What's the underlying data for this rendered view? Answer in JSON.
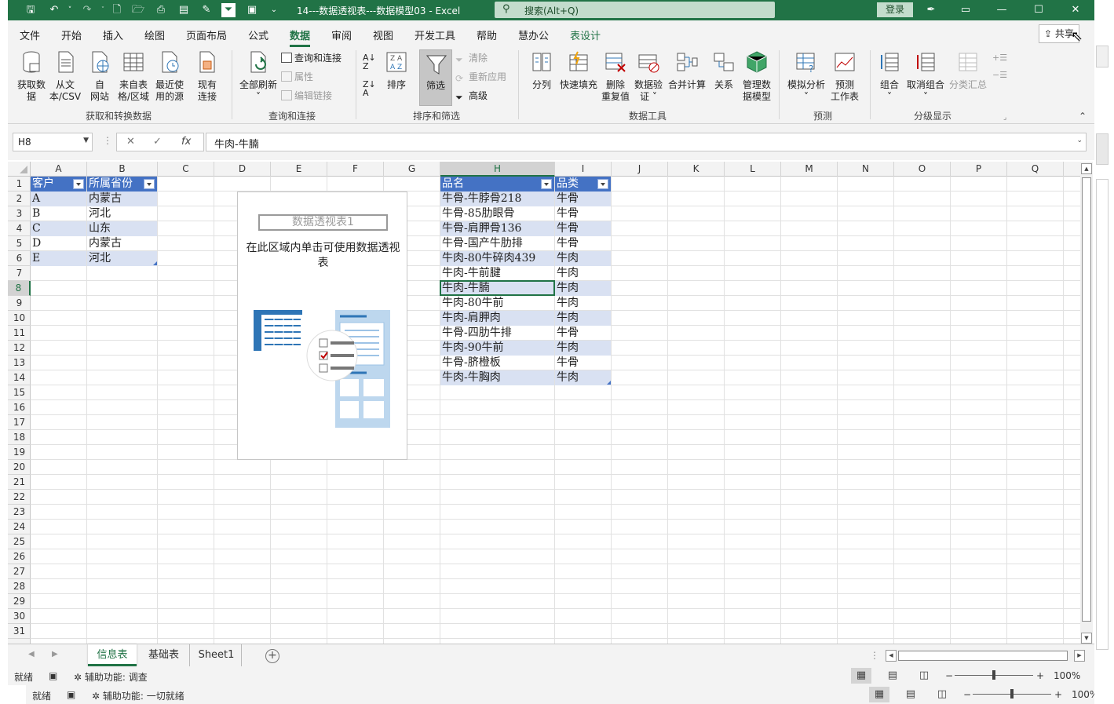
{
  "window": {
    "title": "14---数据透视表---数据模型03  -  Excel",
    "search_placeholder": "搜索(Alt+Q)",
    "login": "登录"
  },
  "menu": {
    "tabs": [
      "文件",
      "开始",
      "插入",
      "绘图",
      "页面布局",
      "公式",
      "数据",
      "审阅",
      "视图",
      "开发工具",
      "帮助",
      "慧办公",
      "表设计"
    ],
    "active": "数据",
    "share": "共享"
  },
  "ribbon": {
    "get_data": [
      "获取数",
      "据"
    ],
    "from_text": [
      "从文",
      "本/CSV"
    ],
    "from_web": [
      "自",
      "网站"
    ],
    "from_table": [
      "来自表",
      "格/区域"
    ],
    "recent_sources": [
      "最近使",
      "用的源"
    ],
    "existing": [
      "现有",
      "连接"
    ],
    "group_get": "获取和转换数据",
    "refresh_all": [
      "全部刷新",
      "˅"
    ],
    "queries": "查询和连接",
    "properties": "属性",
    "edit_links": "编辑链接",
    "group_queries": "查询和连接",
    "sort": "排序",
    "filter": "筛选",
    "clear": "清除",
    "reapply": "重新应用",
    "advanced": "高级",
    "group_sort": "排序和筛选",
    "text_to_columns": "分列",
    "flash_fill": "快速填充",
    "remove_dup": [
      "删除",
      "重复值"
    ],
    "validation": [
      "数据验",
      "证 ˅"
    ],
    "consolidate": "合并计算",
    "relationships": "关系",
    "manage_model": [
      "管理数",
      "据模型"
    ],
    "group_tools": "数据工具",
    "what_if": [
      "模拟分析",
      "˅"
    ],
    "forecast": [
      "预测",
      "工作表"
    ],
    "group_forecast": "预测",
    "group_btn": [
      "组合",
      "˅"
    ],
    "ungroup": [
      "取消组合",
      "˅"
    ],
    "subtotal": "分类汇总",
    "group_outline": "分级显示"
  },
  "formula_bar": {
    "name_box": "H8",
    "formula": "牛肉-牛腩"
  },
  "columns": [
    "A",
    "B",
    "C",
    "D",
    "E",
    "F",
    "G",
    "H",
    "I",
    "J",
    "K",
    "L",
    "M",
    "N",
    "O",
    "P",
    "Q"
  ],
  "rows": [
    "1",
    "2",
    "3",
    "4",
    "5",
    "6",
    "7",
    "8",
    "9",
    "10",
    "11",
    "12",
    "13",
    "14",
    "15",
    "16",
    "17",
    "18",
    "19",
    "20",
    "21",
    "22",
    "23",
    "24",
    "25",
    "26",
    "27",
    "28",
    "29",
    "30",
    "31"
  ],
  "table1": {
    "headers": [
      "客户",
      "所属省份"
    ],
    "rows": [
      [
        "A",
        "内蒙古"
      ],
      [
        "B",
        "河北"
      ],
      [
        "C",
        "山东"
      ],
      [
        "D",
        "内蒙古"
      ],
      [
        "E",
        "河北"
      ]
    ]
  },
  "table2": {
    "headers": [
      "品名",
      "品类"
    ],
    "rows": [
      [
        "牛骨-牛脖骨218",
        "牛骨"
      ],
      [
        "牛骨-85肋眼骨",
        "牛骨"
      ],
      [
        "牛骨-肩胛骨136",
        "牛骨"
      ],
      [
        "牛骨-国产牛肋排",
        "牛骨"
      ],
      [
        "牛肉-80牛碎肉439",
        "牛肉"
      ],
      [
        "牛肉-牛前腱",
        "牛肉"
      ],
      [
        "牛肉-牛腩",
        "牛肉"
      ],
      [
        "牛肉-80牛前",
        "牛肉"
      ],
      [
        "牛肉-肩胛肉",
        "牛肉"
      ],
      [
        "牛骨-四肋牛排",
        "牛骨"
      ],
      [
        "牛肉-90牛前",
        "牛肉"
      ],
      [
        "牛骨-脐橙板",
        "牛骨"
      ],
      [
        "牛肉-牛胸肉",
        "牛肉"
      ]
    ]
  },
  "pivot": {
    "name": "数据透视表1",
    "message": "在此区域内单击可使用数据透视表"
  },
  "sheets": [
    "信息表",
    "基础表",
    "Sheet1"
  ],
  "active_sheet": "信息表",
  "status1": {
    "ready": "就绪",
    "accessibility": "辅助功能: 调查",
    "zoom": "100%"
  },
  "status2": {
    "ready": "就绪",
    "accessibility": "辅助功能: 一切就绪",
    "zoom": "100%"
  },
  "colors": {
    "excel_green": "#217346",
    "table_header": "#4472c4",
    "table_band": "#d9e1f2"
  }
}
